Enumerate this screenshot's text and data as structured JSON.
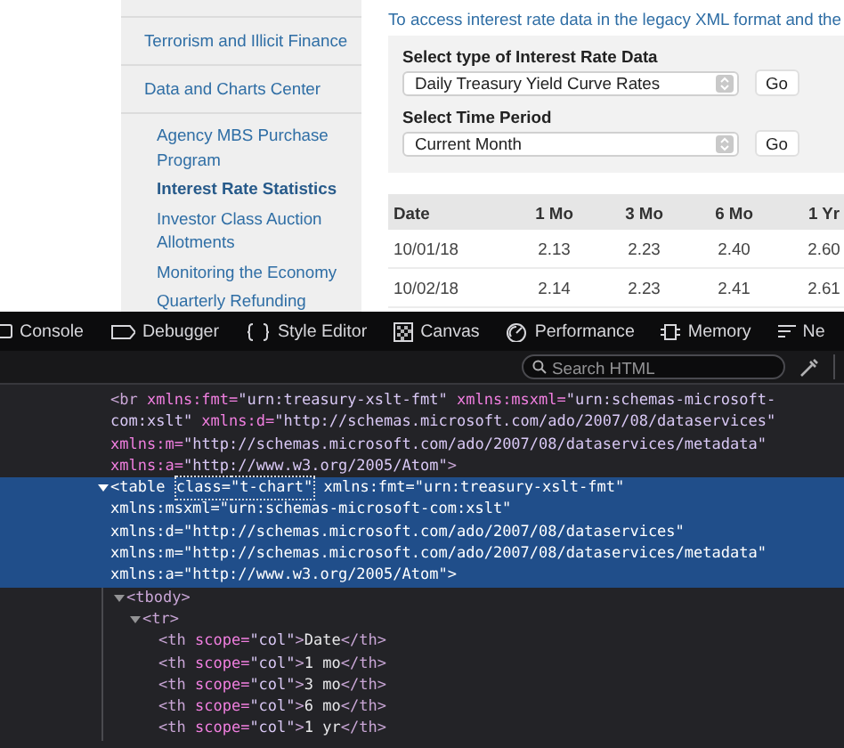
{
  "sidebar": {
    "items": [
      {
        "label": "Terrorism and Illicit Finance",
        "selected": false
      },
      {
        "label": "Data and Charts Center",
        "selected": false,
        "children": [
          {
            "label": "Agency MBS Purchase Program",
            "selected": false
          },
          {
            "label": "Interest Rate Statistics",
            "selected": true
          },
          {
            "label": "Investor Class Auction Allotments",
            "selected": false
          },
          {
            "label": "Monitoring the Economy",
            "selected": false
          },
          {
            "label": "Quarterly Refunding",
            "selected": false
          }
        ]
      }
    ]
  },
  "intro": "To access interest rate data in the legacy XML format and the",
  "form": [
    {
      "label": "Select type of Interest Rate Data",
      "value": "Daily Treasury Yield Curve Rates",
      "button": "Go"
    },
    {
      "label": "Select Time Period",
      "value": "Current Month",
      "button": "Go"
    }
  ],
  "table": {
    "columns": [
      "Date",
      "1 Mo",
      "3 Mo",
      "6 Mo",
      "1 Yr"
    ],
    "rows": [
      [
        "10/01/18",
        "2.13",
        "2.23",
        "2.40",
        "2.60"
      ],
      [
        "10/02/18",
        "2.14",
        "2.23",
        "2.41",
        "2.61"
      ]
    ]
  },
  "devtools": {
    "tabs": [
      {
        "label": "Console"
      },
      {
        "label": "Debugger"
      },
      {
        "label": "Style Editor"
      },
      {
        "label": "Canvas"
      },
      {
        "label": "Performance"
      },
      {
        "label": "Memory"
      },
      {
        "label": "Ne"
      }
    ],
    "search": {
      "placeholder": "Search HTML"
    },
    "nodes": [
      {
        "selected": false,
        "lines": [
          [
            {
              "kind": "tag",
              "text": "<br"
            },
            {
              "kind": "attr",
              "text": " xmlns:fmt="
            },
            {
              "kind": "value",
              "text": "\"urn:treasury-xslt-fmt\""
            },
            {
              "kind": "attr",
              "text": " xmlns:msxml="
            },
            {
              "kind": "value",
              "text": "\"urn:schemas-microsoft-"
            }
          ],
          [
            {
              "kind": "value",
              "text": "com:xslt\""
            },
            {
              "kind": "attr",
              "text": " xmlns:d="
            },
            {
              "kind": "value",
              "text": "\"http://schemas.microsoft.com/ado/2007/08/dataservices\""
            }
          ],
          [
            {
              "kind": "attr",
              "text": "xmlns:m="
            },
            {
              "kind": "value",
              "text": "\"http://schemas.microsoft.com/ado/2007/08/dataservices/metadata\""
            }
          ],
          [
            {
              "kind": "attr",
              "text": "xmlns:a="
            },
            {
              "kind": "value",
              "text": "\"http://www.w3.org/2005/Atom\""
            },
            {
              "kind": "tag",
              "text": ">"
            }
          ]
        ]
      },
      {
        "selected": true,
        "expanded": true,
        "lines": [
          [
            {
              "kind": "tag",
              "text": "<table "
            },
            {
              "kind": "attr",
              "text": "class=",
              "boxed": true
            },
            {
              "kind": "value",
              "text": "\"t-chart\"",
              "boxed": true
            },
            {
              "kind": "attr",
              "text": " xmlns:fmt="
            },
            {
              "kind": "value",
              "text": "\"urn:treasury-xslt-fmt\""
            }
          ],
          [
            {
              "kind": "attr",
              "text": "xmlns:msxml="
            },
            {
              "kind": "value",
              "text": "\"urn:schemas-microsoft-com:xslt\""
            }
          ],
          [
            {
              "kind": "attr",
              "text": "xmlns:d="
            },
            {
              "kind": "value",
              "text": "\"http://schemas.microsoft.com/ado/2007/08/dataservices\""
            }
          ],
          [
            {
              "kind": "attr",
              "text": "xmlns:m="
            },
            {
              "kind": "value",
              "text": "\"http://schemas.microsoft.com/ado/2007/08/dataservices/metadata\""
            }
          ],
          [
            {
              "kind": "attr",
              "text": "xmlns:a="
            },
            {
              "kind": "value",
              "text": "\"http://www.w3.org/2005/Atom\""
            },
            {
              "kind": "tag",
              "text": ">"
            }
          ]
        ],
        "children": [
          {
            "selected": false,
            "expanded": true,
            "lines": [
              [
                {
                  "kind": "tag",
                  "text": "<tbody>"
                }
              ]
            ],
            "children": [
              {
                "selected": false,
                "expanded": true,
                "lines": [
                  [
                    {
                      "kind": "tag",
                      "text": "<tr>"
                    }
                  ]
                ],
                "children": [
                  {
                    "selected": false,
                    "lines": [
                      [
                        {
                          "kind": "tag",
                          "text": "<th"
                        },
                        {
                          "kind": "attr",
                          "text": " scope="
                        },
                        {
                          "kind": "value",
                          "text": "\"col\""
                        },
                        {
                          "kind": "tag",
                          "text": ">"
                        },
                        {
                          "kind": "text",
                          "text": "Date"
                        },
                        {
                          "kind": "tag",
                          "text": "</th>"
                        }
                      ]
                    ]
                  },
                  {
                    "selected": false,
                    "lines": [
                      [
                        {
                          "kind": "tag",
                          "text": "<th"
                        },
                        {
                          "kind": "attr",
                          "text": " scope="
                        },
                        {
                          "kind": "value",
                          "text": "\"col\""
                        },
                        {
                          "kind": "tag",
                          "text": ">"
                        },
                        {
                          "kind": "text",
                          "text": "1 mo"
                        },
                        {
                          "kind": "tag",
                          "text": "</th>"
                        }
                      ]
                    ]
                  },
                  {
                    "selected": false,
                    "lines": [
                      [
                        {
                          "kind": "tag",
                          "text": "<th"
                        },
                        {
                          "kind": "attr",
                          "text": " scope="
                        },
                        {
                          "kind": "value",
                          "text": "\"col\""
                        },
                        {
                          "kind": "tag",
                          "text": ">"
                        },
                        {
                          "kind": "text",
                          "text": "3 mo"
                        },
                        {
                          "kind": "tag",
                          "text": "</th>"
                        }
                      ]
                    ]
                  },
                  {
                    "selected": false,
                    "lines": [
                      [
                        {
                          "kind": "tag",
                          "text": "<th"
                        },
                        {
                          "kind": "attr",
                          "text": " scope="
                        },
                        {
                          "kind": "value",
                          "text": "\"col\""
                        },
                        {
                          "kind": "tag",
                          "text": ">"
                        },
                        {
                          "kind": "text",
                          "text": "6 mo"
                        },
                        {
                          "kind": "tag",
                          "text": "</th>"
                        }
                      ]
                    ]
                  },
                  {
                    "selected": false,
                    "lines": [
                      [
                        {
                          "kind": "tag",
                          "text": "<th"
                        },
                        {
                          "kind": "attr",
                          "text": " scope="
                        },
                        {
                          "kind": "value",
                          "text": "\"col\""
                        },
                        {
                          "kind": "tag",
                          "text": ">"
                        },
                        {
                          "kind": "text",
                          "text": "1 yr"
                        },
                        {
                          "kind": "tag",
                          "text": "</th>"
                        }
                      ]
                    ]
                  }
                ]
              }
            ]
          }
        ]
      }
    ]
  }
}
